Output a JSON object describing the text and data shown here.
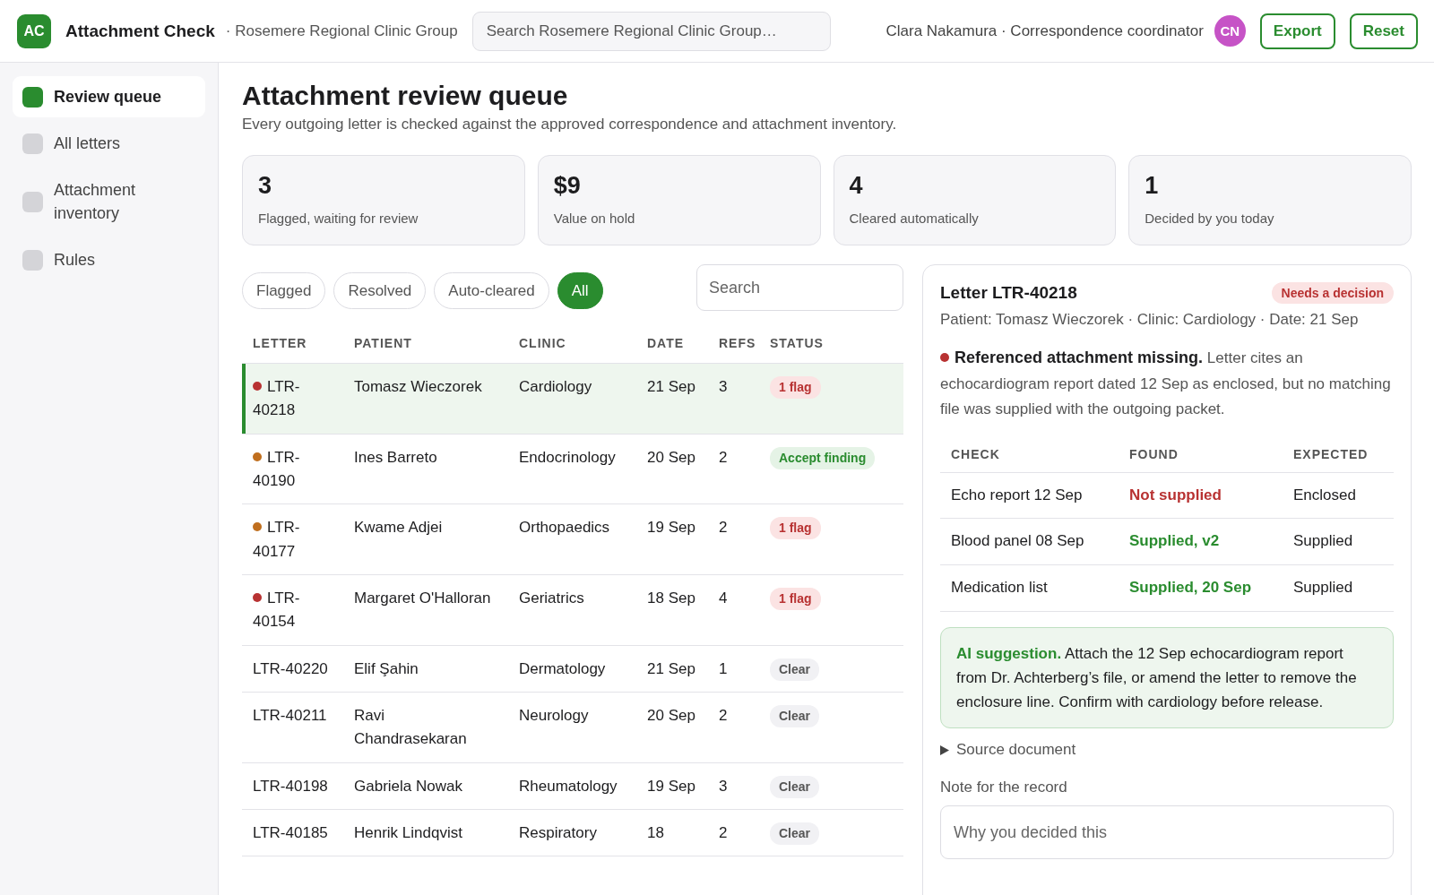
{
  "header": {
    "logo": "AC",
    "app_name": "Attachment Check",
    "org": "· Rosemere Regional Clinic Group",
    "search": {
      "placeholder": "Search Rosemere Regional Clinic Group…"
    },
    "user": "Clara Nakamura · Correspondence coordinator",
    "avatar": "CN",
    "buttons": [
      "Export",
      "Reset"
    ]
  },
  "sidebar": {
    "items": [
      {
        "label": "Review queue",
        "selected": true
      },
      {
        "label": "All letters",
        "selected": false
      },
      {
        "label": "Attachment inventory",
        "selected": false
      },
      {
        "label": "Rules",
        "selected": false
      }
    ]
  },
  "page": {
    "title": "Attachment review queue",
    "subtitle": "Every outgoing letter is checked against the approved correspondence and attachment inventory."
  },
  "stats": [
    {
      "value": "3",
      "label": "Flagged, waiting for review"
    },
    {
      "value": "$9",
      "label": "Value on hold"
    },
    {
      "value": "4",
      "label": "Cleared automatically"
    },
    {
      "value": "1",
      "label": "Decided by you today"
    }
  ],
  "filters": [
    {
      "label": "Flagged",
      "selected": false
    },
    {
      "label": "Resolved",
      "selected": false
    },
    {
      "label": "Auto-cleared",
      "selected": false
    },
    {
      "label": "All",
      "selected": true
    }
  ],
  "table_search": {
    "placeholder": "Search"
  },
  "table": {
    "columns": [
      "LETTER",
      "PATIENT",
      "CLINIC",
      "DATE",
      "REFS",
      "STATUS"
    ],
    "rows": [
      {
        "letter": "LTR-40218",
        "color": "#b83232",
        "patient": "Tomasz Wieczorek",
        "clinic": "Cardiology",
        "date": "21 Sep",
        "refs": "3",
        "status": {
          "label": "1 flag",
          "kind": "flag"
        },
        "selected": true
      },
      {
        "letter": "LTR-40190",
        "color": "#c06f1e",
        "patient": "Ines Barreto",
        "clinic": "Endocrinology",
        "date": "20 Sep",
        "refs": "2",
        "status": {
          "label": "Accept finding",
          "kind": "accept"
        },
        "selected": false
      },
      {
        "letter": "LTR-40177",
        "color": "#c06f1e",
        "patient": "Kwame Adjei",
        "clinic": "Orthopaedics",
        "date": "19 Sep",
        "refs": "2",
        "status": {
          "label": "1 flag",
          "kind": "flag"
        },
        "selected": false
      },
      {
        "letter": "LTR-40154",
        "color": "#b83232",
        "patient": "Margaret O'Halloran",
        "clinic": "Geriatrics",
        "date": "18 Sep",
        "refs": "4",
        "status": {
          "label": "1 flag",
          "kind": "flag"
        },
        "selected": false
      },
      {
        "letter": "LTR-40220",
        "patient": "Elif Şahin",
        "clinic": "Dermatology",
        "date": "21 Sep",
        "refs": "1",
        "status": {
          "label": "Clear",
          "kind": "clear"
        },
        "selected": false
      },
      {
        "letter": "LTR-40211",
        "patient": "Ravi Chandrasekaran",
        "clinic": "Neurology",
        "date": "20 Sep",
        "refs": "2",
        "status": {
          "label": "Clear",
          "kind": "clear"
        },
        "selected": false
      },
      {
        "letter": "LTR-40198",
        "patient": "Gabriela Nowak",
        "clinic": "Rheumatology",
        "date": "19 Sep",
        "refs": "3",
        "status": {
          "label": "Clear",
          "kind": "clear"
        },
        "selected": false
      },
      {
        "letter": "LTR-40185",
        "patient": "Henrik Lindqvist",
        "clinic": "Respiratory",
        "date": "18",
        "refs": "2",
        "status": {
          "label": "Clear",
          "kind": "clear"
        },
        "selected": false
      }
    ]
  },
  "detail": {
    "title": "Letter LTR-40218",
    "badge": "Needs a decision",
    "meta": "Patient: Tomasz Wieczorek · Clinic: Cardiology · Date: 21 Sep",
    "finding": {
      "color": "#b83232",
      "text": "**Referenced attachment missing.** Letter cites an echocardiogram report dated 12 Sep as enclosed, but no matching file was supplied with the outgoing packet."
    },
    "checks": {
      "columns": [
        "CHECK",
        "FOUND",
        "EXPECTED"
      ],
      "rows": [
        {
          "check": "Echo report 12 Sep",
          "found": "Not supplied",
          "kind": "missing",
          "expected": "Enclosed"
        },
        {
          "check": "Blood panel 08 Sep",
          "found": "Supplied, v2",
          "kind": "supplied",
          "expected": "Supplied"
        },
        {
          "check": "Medication list",
          "found": "Supplied, 20 Sep",
          "kind": "supplied",
          "expected": "Supplied"
        }
      ]
    },
    "suggestion": "**AI suggestion.** Attach the 12 Sep echocardiogram report from Dr. Achterberg’s file, or amend the letter to remove the enclosure line. Confirm with cardiology before release.",
    "source": {
      "label": "Source document",
      "expanded": false
    },
    "note": {
      "label": "Note for the record",
      "placeholder": "Why you decided this"
    }
  }
}
